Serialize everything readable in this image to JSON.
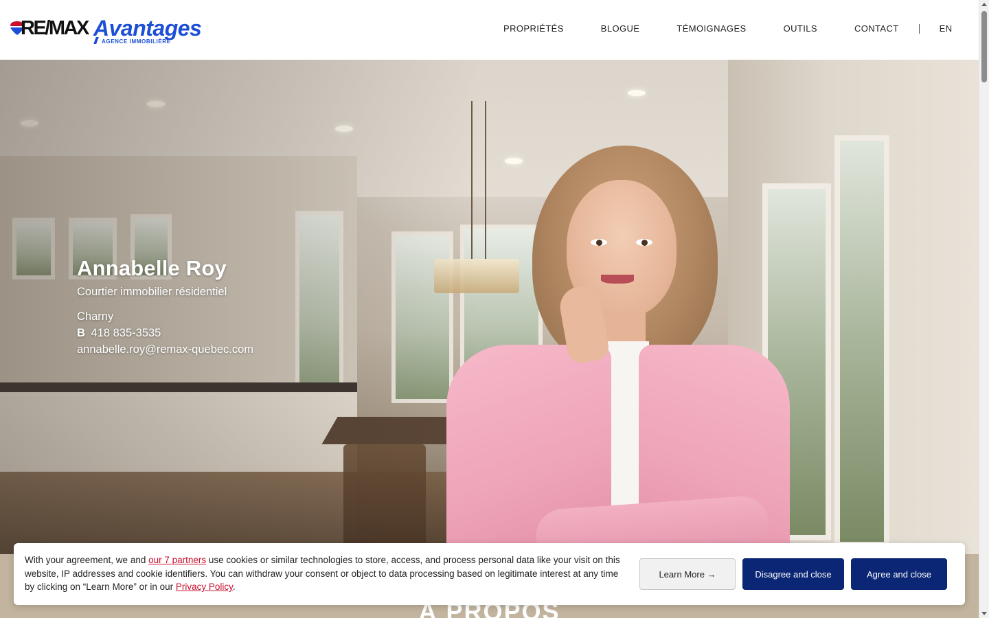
{
  "brand": {
    "logo_remax": "RE/MAX",
    "logo_avantages": "Avantages",
    "logo_tagline": "AGENCE IMMOBILIÈRE",
    "colors": {
      "blue": "#1c4fd6",
      "red": "#c8102e",
      "navy": "#0a2674"
    }
  },
  "nav": {
    "items": [
      "PROPRIÉTÉS",
      "BLOGUE",
      "TÉMOIGNAGES",
      "OUTILS",
      "CONTACT"
    ],
    "language": "EN"
  },
  "agent": {
    "name": "Annabelle Roy",
    "title": "Courtier immobilier résidentiel",
    "city": "Charny",
    "phone_label": "B",
    "phone": "418 835-3535",
    "email": "annabelle.roy@remax-quebec.com"
  },
  "about": {
    "title": "À PROPOS"
  },
  "cookie": {
    "text_before": "With your agreement, we and ",
    "partners_link": "our 7 partners",
    "text_middle": " use cookies or similar technologies to store, access, and process personal data like your visit on this website, IP addresses and cookie identifiers. You can withdraw your consent or object to data processing based on legitimate interest at any time by clicking on “Learn More” or in our ",
    "privacy_link": "Privacy Policy",
    "text_after": ".",
    "learn_more": "Learn More →",
    "disagree": "Disagree and close",
    "agree": "Agree and close"
  }
}
